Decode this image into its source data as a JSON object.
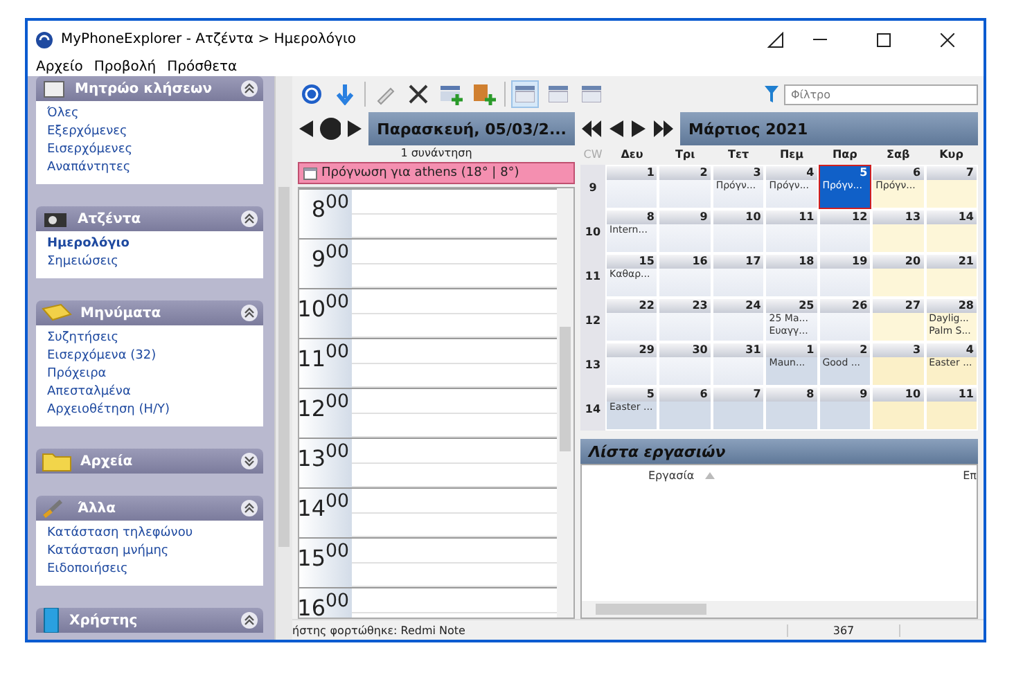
{
  "window": {
    "title": "MyPhoneExplorer -  Ατζέντα > Ημερολόγιο"
  },
  "menu": [
    "Αρχείο",
    "Προβολή",
    "Πρόσθετα"
  ],
  "sidebar": [
    {
      "kind": "calls",
      "title": "Μητρώο κλήσεων",
      "expanded": true,
      "items": [
        {
          "label": "Όλες",
          "selected": false
        },
        {
          "label": "Εξερχόμενες",
          "selected": false
        },
        {
          "label": "Εισερχόμενες",
          "selected": false
        },
        {
          "label": "Αναπάντητες",
          "selected": false
        }
      ]
    },
    {
      "kind": "agenda",
      "title": "Ατζέντα",
      "expanded": true,
      "items": [
        {
          "label": "Ημερολόγιο",
          "selected": true
        },
        {
          "label": "Σημειώσεις",
          "selected": false
        }
      ]
    },
    {
      "kind": "messages",
      "title": "Μηνύματα",
      "expanded": true,
      "items": [
        {
          "label": "Συζητήσεις",
          "selected": false
        },
        {
          "label": "Εισερχόμενα (32)",
          "selected": false
        },
        {
          "label": "Πρόχειρα",
          "selected": false
        },
        {
          "label": "Απεσταλμένα",
          "selected": false
        },
        {
          "label": "Αρχειοθέτηση (Η/Υ)",
          "selected": false
        }
      ]
    },
    {
      "kind": "files",
      "title": "Αρχεία",
      "expanded": false
    },
    {
      "kind": "tools",
      "title": "Άλλα",
      "expanded": true,
      "items": [
        {
          "label": "Κατάσταση τηλεφώνου",
          "selected": false
        },
        {
          "label": "Κατάσταση μνήμης",
          "selected": false
        },
        {
          "label": "Ειδοποιήσεις",
          "selected": false
        }
      ]
    },
    {
      "kind": "user",
      "title": "Χρήστης",
      "expanded": true
    }
  ],
  "toolbar": {
    "views": [
      {
        "selected": true
      },
      {
        "selected": false
      },
      {
        "selected": false
      }
    ],
    "filter": {
      "placeholder": "Φίλτρο"
    }
  },
  "day": {
    "title": "Παρασκευή, 05/03/2...",
    "count": "1 συνάντηση",
    "all_day": "Πρόγνωση για athens (18° | 8°)",
    "hours": [
      {
        "hour": "8",
        "min": "00"
      },
      {
        "hour": "9",
        "min": "00"
      },
      {
        "hour": "10",
        "min": "00"
      },
      {
        "hour": "11",
        "min": "00"
      },
      {
        "hour": "12",
        "min": "00"
      },
      {
        "hour": "13",
        "min": "00"
      },
      {
        "hour": "14",
        "min": "00"
      },
      {
        "hour": "15",
        "min": "00"
      },
      {
        "hour": "16",
        "min": "00"
      }
    ]
  },
  "month": {
    "title": "Μάρτιος 2021",
    "cw": "CW",
    "weekdays": [
      "Δευ",
      "Τρι",
      "Τετ",
      "Πεμ",
      "Παρ",
      "Σαβ",
      "Κυρ"
    ],
    "weeks": [
      {
        "cw": "9",
        "days": [
          {
            "day": "1",
            "other_month": false,
            "selected": false
          },
          {
            "day": "2",
            "other_month": false,
            "selected": false
          },
          {
            "day": "3",
            "events": [
              "Πρόγν..."
            ],
            "other_month": false,
            "selected": false
          },
          {
            "day": "4",
            "events": [
              "Πρόγν..."
            ],
            "other_month": false,
            "selected": false
          },
          {
            "day": "5",
            "events": [
              "Πρόγν..."
            ],
            "other_month": false,
            "selected": true
          },
          {
            "day": "6",
            "events": [
              "Πρόγν..."
            ],
            "other_month": false,
            "selected": false
          },
          {
            "day": "7",
            "other_month": false,
            "selected": false
          }
        ]
      },
      {
        "cw": "10",
        "days": [
          {
            "day": "8",
            "events": [
              "Intern..."
            ],
            "other_month": false,
            "selected": false
          },
          {
            "day": "9",
            "other_month": false,
            "selected": false
          },
          {
            "day": "10",
            "other_month": false,
            "selected": false
          },
          {
            "day": "11",
            "other_month": false,
            "selected": false
          },
          {
            "day": "12",
            "other_month": false,
            "selected": false
          },
          {
            "day": "13",
            "other_month": false,
            "selected": false
          },
          {
            "day": "14",
            "other_month": false,
            "selected": false
          }
        ]
      },
      {
        "cw": "11",
        "days": [
          {
            "day": "15",
            "events": [
              "Καθαρ..."
            ],
            "other_month": false,
            "selected": false
          },
          {
            "day": "16",
            "other_month": false,
            "selected": false
          },
          {
            "day": "17",
            "other_month": false,
            "selected": false
          },
          {
            "day": "18",
            "other_month": false,
            "selected": false
          },
          {
            "day": "19",
            "other_month": false,
            "selected": false
          },
          {
            "day": "20",
            "other_month": false,
            "selected": false
          },
          {
            "day": "21",
            "other_month": false,
            "selected": false
          }
        ]
      },
      {
        "cw": "12",
        "days": [
          {
            "day": "22",
            "other_month": false,
            "selected": false
          },
          {
            "day": "23",
            "other_month": false,
            "selected": false
          },
          {
            "day": "24",
            "other_month": false,
            "selected": false
          },
          {
            "day": "25",
            "events": [
              "25 Ma...",
              "Ευαγγ..."
            ],
            "other_month": false,
            "selected": false
          },
          {
            "day": "26",
            "other_month": false,
            "selected": false
          },
          {
            "day": "27",
            "other_month": false,
            "selected": false
          },
          {
            "day": "28",
            "events": [
              "Daylig...",
              "Palm S..."
            ],
            "other_month": false,
            "selected": false
          }
        ]
      },
      {
        "cw": "13",
        "days": [
          {
            "day": "29",
            "other_month": false,
            "selected": false
          },
          {
            "day": "30",
            "other_month": false,
            "selected": false
          },
          {
            "day": "31",
            "other_month": false,
            "selected": false
          },
          {
            "day": "1",
            "events": [
              "Maun..."
            ],
            "other_month": true,
            "selected": false
          },
          {
            "day": "2",
            "events": [
              "Good ..."
            ],
            "other_month": true,
            "selected": false
          },
          {
            "day": "3",
            "other_month": true,
            "selected": false
          },
          {
            "day": "4",
            "events": [
              "Easter ..."
            ],
            "other_month": true,
            "selected": false
          }
        ]
      },
      {
        "cw": "14",
        "days": [
          {
            "day": "5",
            "events": [
              "Easter ..."
            ],
            "other_month": true,
            "selected": false
          },
          {
            "day": "6",
            "other_month": true,
            "selected": false
          },
          {
            "day": "7",
            "other_month": true,
            "selected": false
          },
          {
            "day": "8",
            "other_month": true,
            "selected": false
          },
          {
            "day": "9",
            "other_month": true,
            "selected": false
          },
          {
            "day": "10",
            "other_month": true,
            "selected": false
          },
          {
            "day": "11",
            "other_month": true,
            "selected": false
          }
        ]
      }
    ]
  },
  "tasks": {
    "title": "Λίστα εργασιών",
    "columns": [
      "Εργασία",
      "Επ"
    ]
  },
  "status_bar": {
    "text": "ήστης φορτώθηκε: Redmi Note",
    "count": "367"
  }
}
